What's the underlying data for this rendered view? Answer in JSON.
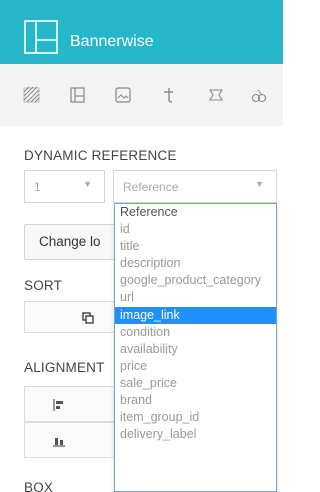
{
  "app": {
    "brand": "Bannerwise",
    "accent": "#27b7cb"
  },
  "toolbar": {
    "tools": [
      "pattern-icon",
      "layout-icon",
      "image-icon",
      "text-icon",
      "shape-icon",
      "more-icon"
    ]
  },
  "dynamic_reference": {
    "title": "DYNAMIC REFERENCE",
    "index_value": "1",
    "field_value": "Reference"
  },
  "change_button": {
    "label": "Change lo"
  },
  "sort": {
    "title": "SORT"
  },
  "alignment": {
    "title": "ALIGNMENT"
  },
  "box": {
    "title": "BOX"
  },
  "dropdown": {
    "highlight_color": "#1e90ff",
    "options": [
      "Reference",
      "id",
      "title",
      "description",
      "google_product_category",
      "url",
      "image_link",
      "condition",
      "availability",
      "price",
      "sale_price",
      "brand",
      "item_group_id",
      "delivery_label"
    ],
    "selected": "image_link"
  }
}
